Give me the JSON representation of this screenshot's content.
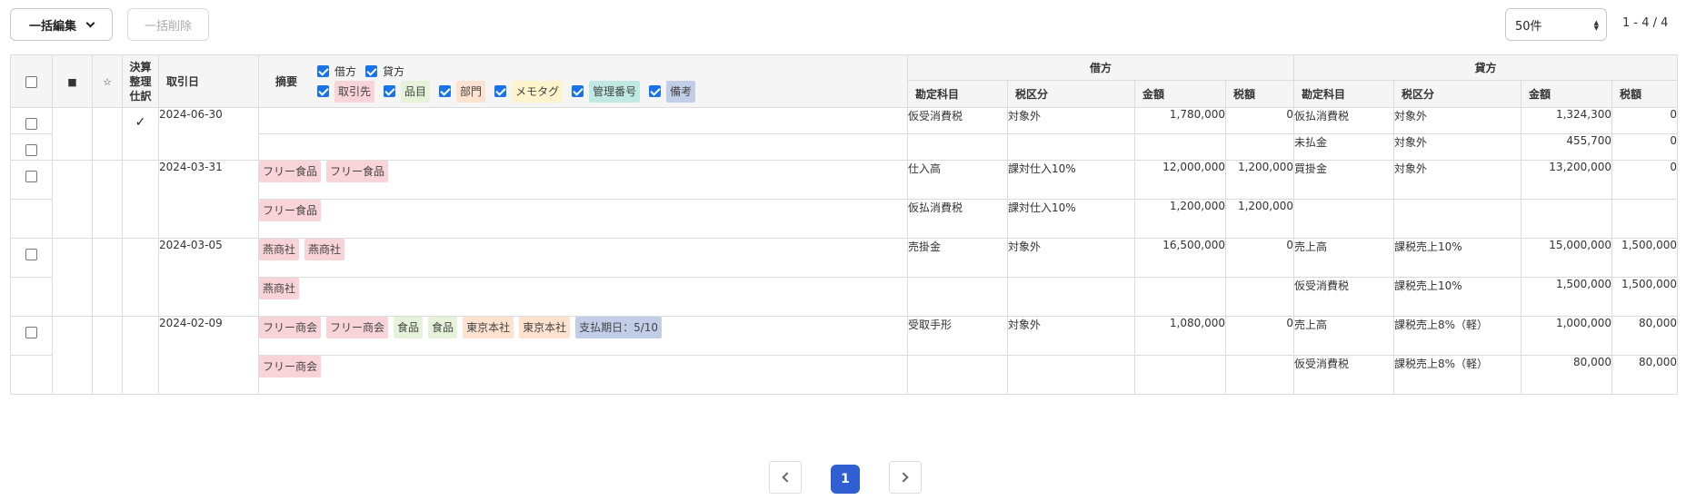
{
  "toolbar": {
    "bulk_edit_label": "一括編集",
    "bulk_delete_label": "一括削除",
    "per_page": "50件",
    "range": "1 - 4 / 4"
  },
  "header": {
    "closing_adjustment": [
      "決算",
      "整理",
      "仕訳"
    ],
    "date": "取引日",
    "summary": "摘要",
    "debit_group": "借方",
    "credit_group": "貸方",
    "account": "勘定科目",
    "tax_class": "税区分",
    "amount": "金額",
    "tax": "税額",
    "filters_row1": [
      {
        "label": "借方"
      },
      {
        "label": "貸方"
      }
    ],
    "filters_row2": [
      {
        "label": "取引先"
      },
      {
        "label": "品目"
      },
      {
        "label": "部門"
      },
      {
        "label": "メモタグ"
      },
      {
        "label": "管理番号"
      },
      {
        "label": "備考"
      }
    ]
  },
  "rows": [
    {
      "date": "2024-06-30",
      "closing": "✓",
      "lines": [
        {
          "tags": [],
          "d_account": "仮受消費税",
          "d_tax_class": "対象外",
          "d_amount": "1,780,000",
          "d_tax": "0",
          "c_account": "仮払消費税",
          "c_tax_class": "対象外",
          "c_amount": "1,324,300",
          "c_tax": "0"
        },
        {
          "tags": [],
          "d_account": "",
          "d_tax_class": "",
          "d_amount": "",
          "d_tax": "",
          "c_account": "未払金",
          "c_tax_class": "対象外",
          "c_amount": "455,700",
          "c_tax": "0"
        }
      ]
    },
    {
      "date": "2024-03-31",
      "lines": [
        {
          "tags": [
            "フリー食品",
            "フリー食品"
          ],
          "d_account": "仕入高",
          "d_tax_class": "課対仕入10%",
          "d_amount": "12,000,000",
          "d_tax": "1,200,000",
          "c_account": "買掛金",
          "c_tax_class": "対象外",
          "c_amount": "13,200,000",
          "c_tax": "0"
        },
        {
          "tags": [
            "フリー食品"
          ],
          "d_account": "仮払消費税",
          "d_tax_class": "課対仕入10%",
          "d_amount": "1,200,000",
          "d_tax": "1,200,000",
          "c_account": "",
          "c_tax_class": "",
          "c_amount": "",
          "c_tax": ""
        }
      ]
    },
    {
      "date": "2024-03-05",
      "lines": [
        {
          "tags": [
            "燕商社",
            "燕商社"
          ],
          "d_account": "売掛金",
          "d_tax_class": "対象外",
          "d_amount": "16,500,000",
          "d_tax": "0",
          "c_account": "売上高",
          "c_tax_class": "課税売上10%",
          "c_amount": "15,000,000",
          "c_tax": "1,500,000"
        },
        {
          "tags": [
            "燕商社"
          ],
          "d_account": "",
          "d_tax_class": "",
          "d_amount": "",
          "d_tax": "",
          "c_account": "仮受消費税",
          "c_tax_class": "課税売上10%",
          "c_amount": "1,500,000",
          "c_tax": "1,500,000"
        }
      ]
    },
    {
      "date": "2024-02-09",
      "lines": [
        {
          "tags": [
            "フリー商会",
            "フリー商会",
            "食品",
            "食品",
            "東京本社",
            "東京本社",
            "支払期日：5/10"
          ],
          "d_account": "受取手形",
          "d_tax_class": "対象外",
          "d_amount": "1,080,000",
          "d_tax": "0",
          "c_account": "売上高",
          "c_tax_class": "課税売上8%（軽）",
          "c_amount": "1,000,000",
          "c_tax": "80,000"
        },
        {
          "tags": [
            "フリー商会"
          ],
          "d_account": "",
          "d_tax_class": "",
          "d_amount": "",
          "d_tax": "",
          "c_account": "仮受消費税",
          "c_tax_class": "課税売上8%（軽）",
          "c_amount": "80,000",
          "c_tax": "80,000"
        }
      ]
    }
  ],
  "tag_colors": {
    "partner": "#f8d3d8",
    "item": "#e6f2d9",
    "dept": "#fde2cf",
    "memo": "#fdf4cc",
    "mgmt": "#bfe9e2",
    "remark": "#c2cde8"
  },
  "pagination": {
    "current": "1"
  },
  "accent": "#2f5fd1"
}
